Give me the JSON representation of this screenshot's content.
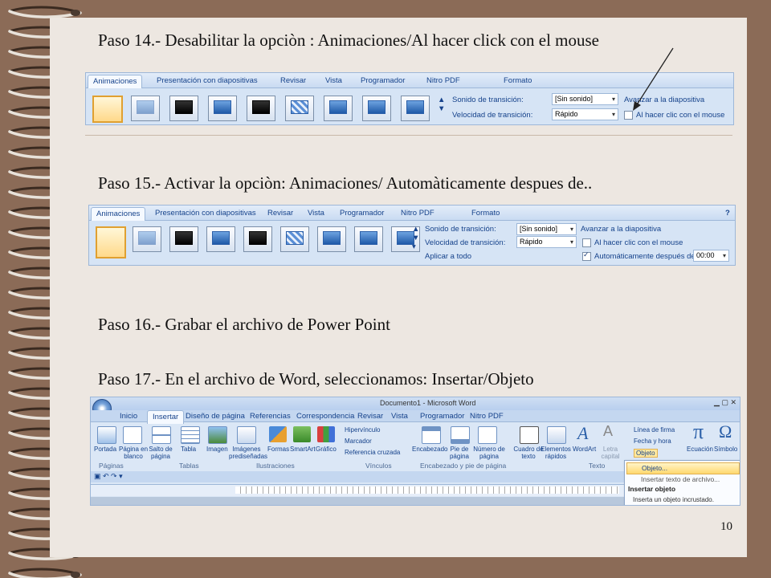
{
  "steps": {
    "s14": "Paso 14.- Desabilitar la opciòn : Animaciones/Al hacer click con el mouse",
    "s15": "Paso 15.- Activar la opciòn: Animaciones/ Automàticamente despues de..",
    "s16": "Paso 16.- Grabar el archivo de Power Point",
    "s17": "Paso 17.-  En el archivo de Word, seleccionamos: Insertar/Objeto"
  },
  "page_number": "10",
  "ppt_ribbon": {
    "tabs": [
      "Animaciones",
      "Presentación con diapositivas",
      "Revisar",
      "Vista",
      "Programador",
      "Nitro PDF",
      "Formato"
    ],
    "sound_label": "Sonido de transición:",
    "sound_value": "[Sin sonido]",
    "speed_label": "Velocidad de transición:",
    "speed_value": "Rápido",
    "apply_all": "Aplicar a todo",
    "advance_title": "Avanzar a la diapositiva",
    "on_click": "Al hacer clic con el mouse",
    "auto_after": "Automáticamente después de:",
    "auto_time": "00:00"
  },
  "word": {
    "title": "Documento1 - Microsoft Word",
    "tabs": [
      "Inicio",
      "Insertar",
      "Diseño de página",
      "Referencias",
      "Correspondencia",
      "Revisar",
      "Vista",
      "Programador",
      "Nitro PDF"
    ],
    "buttons": {
      "portada": "Portada",
      "pagina_blanco": "Página en blanco",
      "salto": "Salto de página",
      "tabla": "Tabla",
      "imagen": "Imagen",
      "imagenes_pred": "Imágenes prediseñadas",
      "formas": "Formas",
      "smartart": "SmartArt",
      "grafico": "Gráfico",
      "hipervinculo": "Hipervínculo",
      "marcador": "Marcador",
      "referencia": "Referencia cruzada",
      "encabezado": "Encabezado",
      "pie": "Pie de página",
      "numero": "Número de página",
      "cuadro": "Cuadro de texto",
      "elementos": "Elementos rápidos",
      "wordart": "WordArt",
      "letra": "Letra capital",
      "linea_firma": "Línea de firma",
      "fecha": "Fecha y hora",
      "objeto": "Objeto",
      "ecuacion": "Ecuación",
      "simbolo": "Símbolo"
    },
    "groups": [
      "Páginas",
      "Tablas",
      "Ilustraciones",
      "Vínculos",
      "Encabezado y pie de página",
      "Texto"
    ],
    "menu": {
      "item1": "Objeto...",
      "item2": "Insertar texto de archivo...",
      "tip_title": "Insertar objeto",
      "tip_text": "Inserta un objeto incrustado."
    }
  }
}
